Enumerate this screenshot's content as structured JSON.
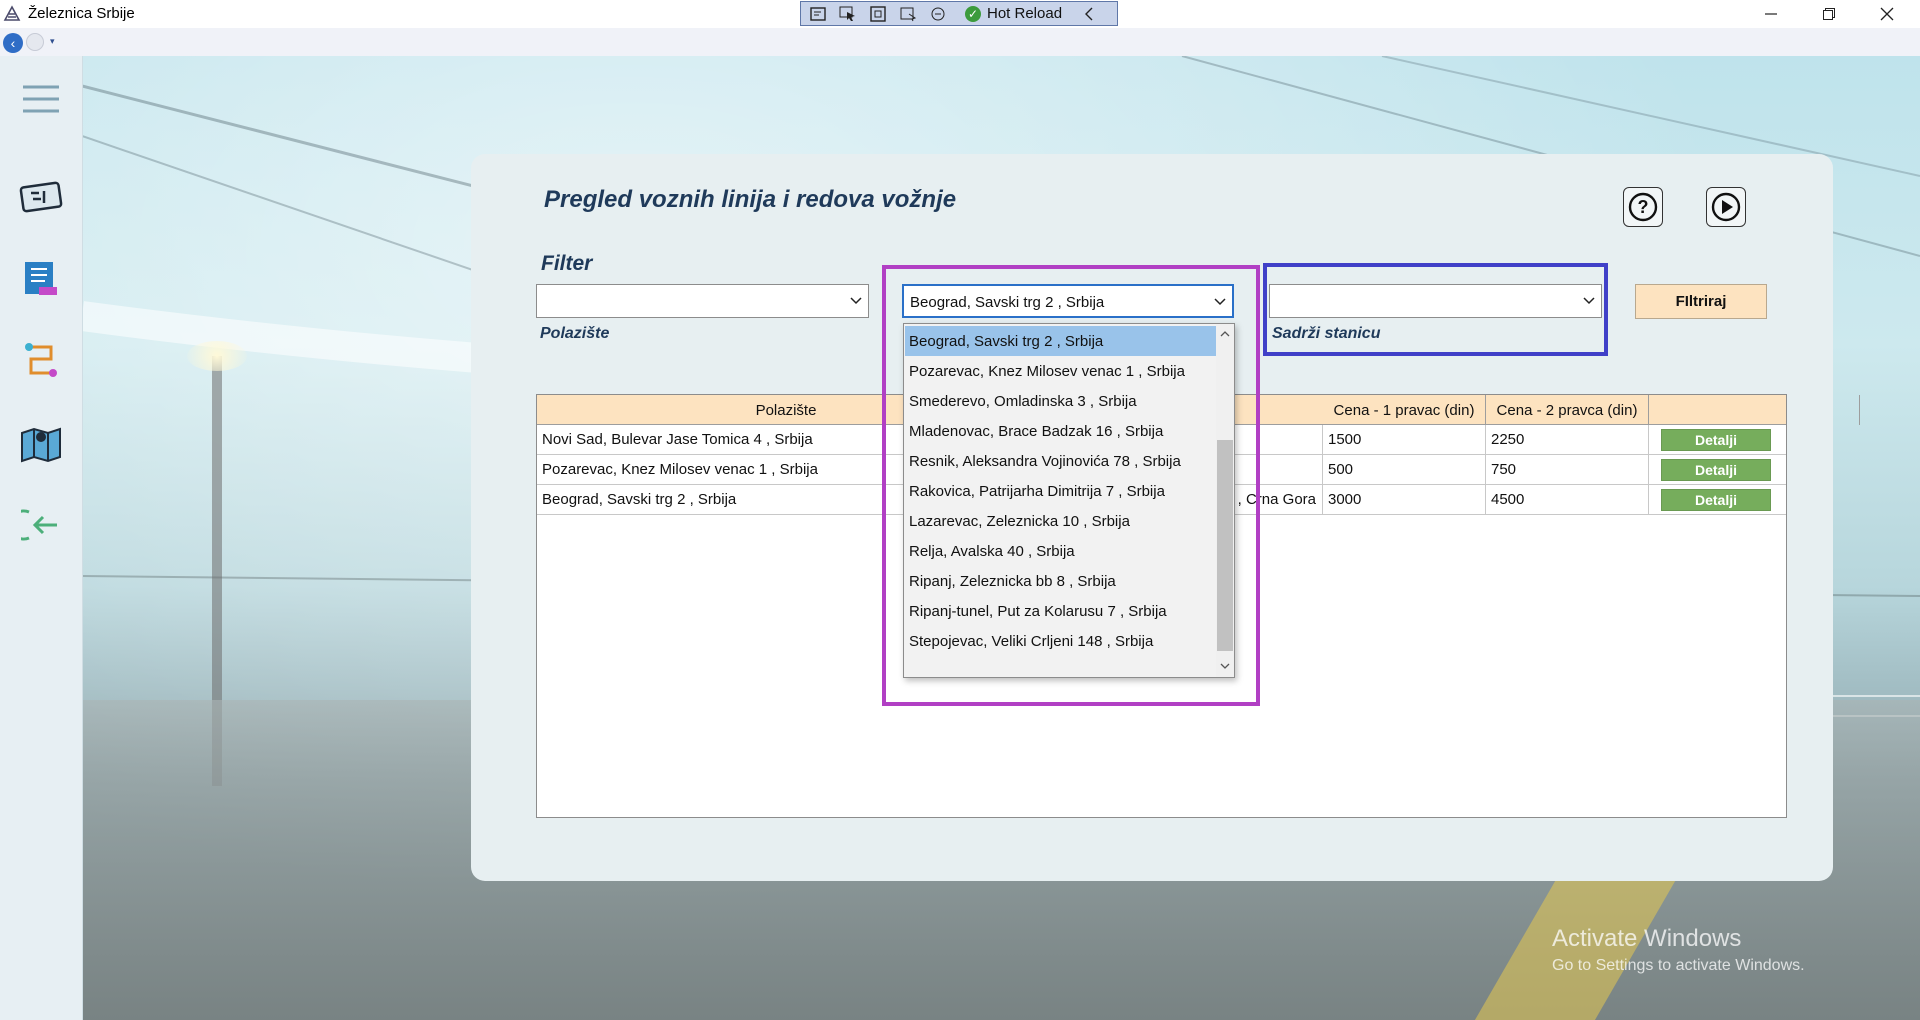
{
  "window": {
    "title": "Železnica Srbije",
    "toolbar_label": "Hot Reload"
  },
  "page": {
    "title": "Pregled voznih linija i redova vožnje",
    "filter_label": "Filter"
  },
  "filters": {
    "from_label": "Polazište",
    "from_value": "",
    "to_value": "Beograd, Savski trg 2 , Srbija",
    "station_label": "Sadrži stanicu",
    "station_value": "",
    "button_label": "FIltriraj"
  },
  "dropdown": {
    "items": [
      "Beograd, Savski trg 2 , Srbija",
      "Pozarevac, Knez Milosev venac 1 , Srbija",
      "Smederevo, Omladinska 3 , Srbija",
      "Mladenovac, Brace Badzak 16 , Srbija",
      "Resnik, Aleksandra Vojinovića 78 , Srbija",
      "Rakovica, Patrijarha Dimitrija 7 , Srbija",
      "Lazarevac, Zeleznicka 10 , Srbija",
      "Relja, Avalska 40 , Srbija",
      "Ripanj, Zeleznicka bb 8 , Srbija",
      "Ripanj-tunel, Put za Kolarusu 7 , Srbija",
      "Stepojevac, Veliki Crljeni 148 , Srbija"
    ],
    "selected_index": 0
  },
  "table": {
    "headers": [
      "Polazište",
      "Cena - 1 pravac (din)",
      "Cena - 2 pravca (din)"
    ],
    "rows": [
      {
        "from": "Novi Sad, Bulevar Jase Tomica 4 , Srbija",
        "partial": "",
        "price1": "1500",
        "price2": "2250",
        "action": "Detalji"
      },
      {
        "from": "Pozarevac, Knez Milosev venac 1 , Srbija",
        "partial": "",
        "price1": "500",
        "price2": "750",
        "action": "Detalji"
      },
      {
        "from": "Beograd, Savski trg 2 , Srbija",
        "partial": "5 , Crna Gora",
        "price1": "3000",
        "price2": "4500",
        "action": "Detalji"
      }
    ]
  },
  "watermark": {
    "line1": "Activate Windows",
    "line2": "Go to Settings to activate Windows."
  },
  "colors": {
    "table_header": "#fde3c0",
    "detail_button": "#76ad5c",
    "highlight_purple": "#b13fc4",
    "highlight_blue": "#4040c8",
    "title_text": "#1f3a5a"
  },
  "icons": {
    "sidebar": [
      "hamburger-menu-icon",
      "ticket-icon",
      "timetable-icon",
      "route-icon",
      "map-icon",
      "logout-icon"
    ],
    "header": [
      "help-icon",
      "play-icon"
    ]
  }
}
